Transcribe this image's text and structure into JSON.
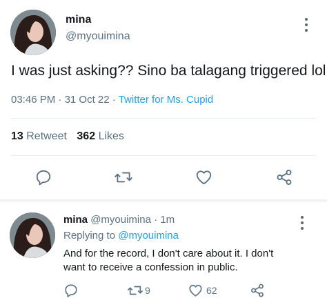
{
  "main_tweet": {
    "name": "mina",
    "handle": "@myouimina",
    "text": "I was just asking?? Sino ba talagang triggered lol",
    "time": "03:46 PM",
    "date": "31 Oct 22",
    "sep1": "·",
    "sep2": "·",
    "source": "Twitter for Ms. Cupid",
    "retweets": "13",
    "retweets_label": "Retweet",
    "likes": "362",
    "likes_label": "Likes"
  },
  "reply": {
    "name": "mina",
    "handle": "@myouimina",
    "sep": "·",
    "age": "1m",
    "replying_prefix": "Replying to",
    "replying_to": "@myouimina",
    "text_line1": "And for the record, I don't care about it. I don't",
    "text_line2": "want to receive a confession in public.",
    "retweet_count": "9",
    "like_count": "62"
  },
  "colors": {
    "link": "#1da1f2",
    "secondary": "#5b7083",
    "divider": "#e6ecf0"
  },
  "icons": [
    "reply-icon",
    "retweet-icon",
    "like-icon",
    "share-icon",
    "more-icon"
  ]
}
